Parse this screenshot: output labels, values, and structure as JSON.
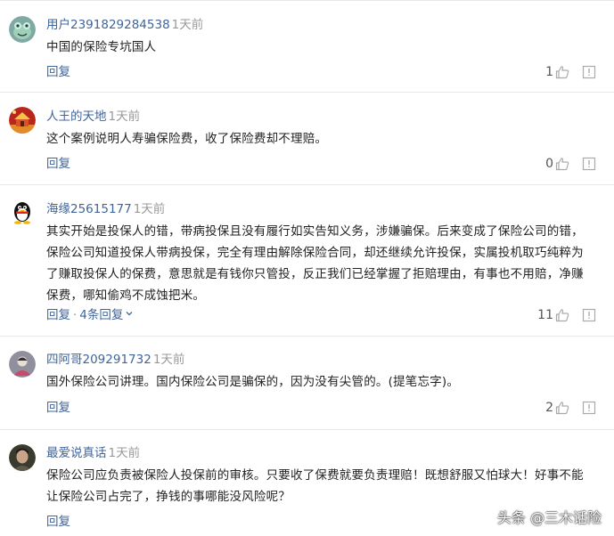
{
  "colors": {
    "username": "#406599",
    "time": "#999999",
    "link": "#406599",
    "text": "#222222",
    "divider": "#e8e8e8"
  },
  "comments": [
    {
      "avatar_icon": "frog-avatar-icon",
      "username": "用户2391829284538",
      "time": "1天前",
      "lines": [
        "中国的保险专坑国人"
      ],
      "reply_label": "回复",
      "more_replies": "",
      "likes": "1"
    },
    {
      "avatar_icon": "temple-avatar-icon",
      "username": "人王的天地",
      "time": "1天前",
      "lines": [
        "这个案例说明人寿骗保险费，收了保险费却不理赔。"
      ],
      "reply_label": "回复",
      "more_replies": "",
      "likes": "0"
    },
    {
      "avatar_icon": "penguin-avatar-icon",
      "username": "海缘25615177",
      "time": "1天前",
      "lines": [
        "其实开始是投保人的错，带病投保且没有履行如实告知义务，涉嫌骗保。后来变成了保险公司的错，",
        "保险公司知道投保人带病投保，完全有理由解除保险合同，却还继续允许投保，实属投机取巧纯粹为",
        "了赚取投保人的保费，意思就是有钱你只管投，反正我们已经掌握了拒赔理由，有事也不用赔，净赚",
        "保费，哪知偷鸡不成蚀把米。"
      ],
      "reply_label": "回复",
      "more_replies": "4条回复",
      "likes": "11"
    },
    {
      "avatar_icon": "person-avatar-icon",
      "username": "四阿哥209291732",
      "time": "1天前",
      "lines": [
        "国外保险公司讲理。国内保险公司是骗保的，因为没有尖管的。(提笔忘字)。"
      ],
      "reply_label": "回复",
      "more_replies": "",
      "likes": "2"
    },
    {
      "avatar_icon": "portrait-avatar-icon",
      "username": "最爱说真话",
      "time": "1天前",
      "lines": [
        "保险公司应负责被保险人投保前的审核。只要收了保费就要负责理赔！既想舒服又怕球大！好事不能",
        "让保险公司占完了，挣钱的事哪能没风险呢？"
      ],
      "reply_label": "回复",
      "more_replies": "",
      "likes": ""
    }
  ],
  "watermark": "头条 @三木话险"
}
